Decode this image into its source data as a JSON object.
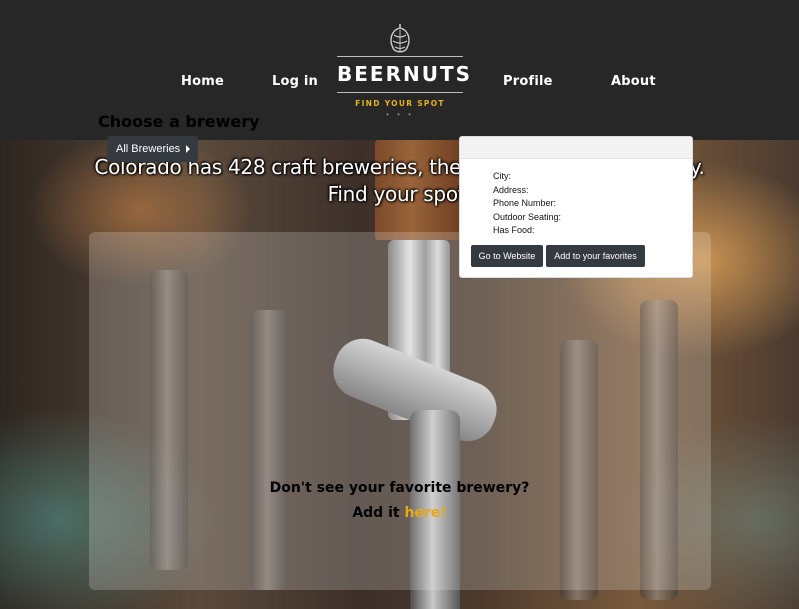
{
  "nav": {
    "home": "Home",
    "login": "Log in",
    "profile": "Profile",
    "about": "About"
  },
  "logo": {
    "name": "BEERNUTS",
    "tagline": "FIND YOUR SPOT",
    "dots": "• • •"
  },
  "hero": {
    "headline_line1": "Colorado has 428 craft breweries, the 2nd most in the country.",
    "headline_line2": "Find your spot."
  },
  "chooser": {
    "title": "Choose a brewery",
    "dropdown_label": "All Breweries"
  },
  "card": {
    "fields": [
      "City:",
      "Address:",
      "Phone Number:",
      "Outdoor Seating:",
      "Has Food:"
    ],
    "website_button": "Go to Website",
    "favorites_button": "Add to your favorites"
  },
  "cta": {
    "question": "Don't see your favorite brewery?",
    "add_prefix": "Add it ",
    "add_link": "here!"
  },
  "colors": {
    "header_bg": "#272727",
    "accent_gold": "#e6a817",
    "button_dark": "#343a40"
  }
}
